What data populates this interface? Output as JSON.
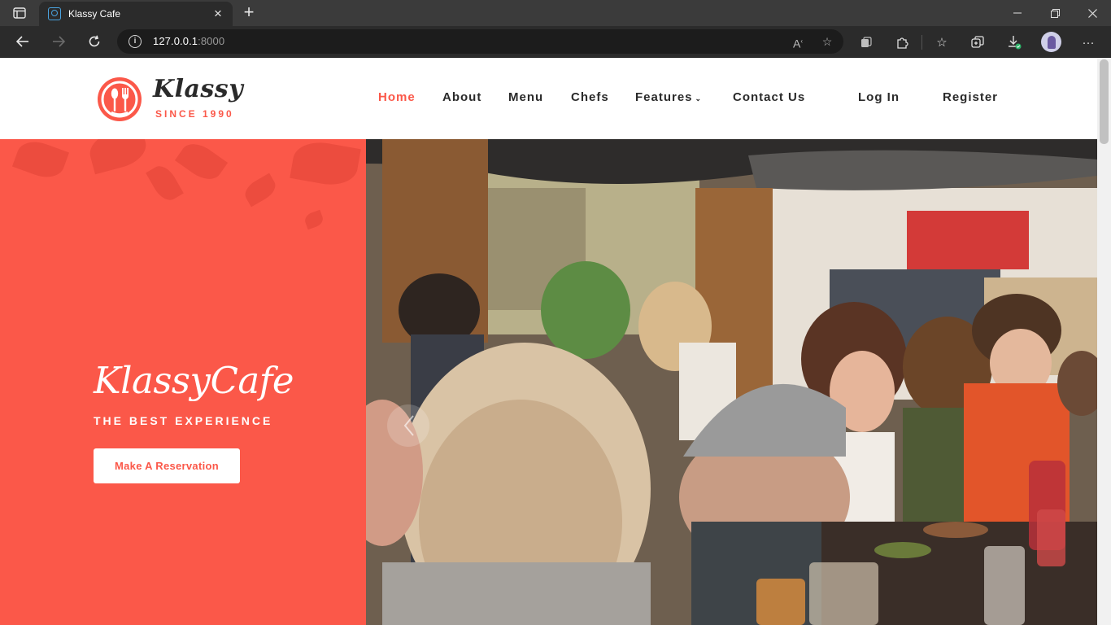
{
  "browser": {
    "tab_title": "Klassy Cafe",
    "url_host": "127.0.0.1",
    "url_port": ":8000",
    "icons": [
      "tab-actions-icon",
      "favicon-icon",
      "close-icon",
      "plus-icon",
      "minimize-icon",
      "maximize-icon",
      "close-window-icon",
      "back-icon",
      "forward-icon",
      "refresh-icon",
      "info-icon",
      "read-aloud-icon",
      "add-favorite-icon",
      "extensions-icon",
      "favorites-icon",
      "collections-icon",
      "downloads-icon",
      "profile-avatar",
      "more-icon"
    ]
  },
  "site": {
    "logo_name": "Klassy",
    "logo_since": "SINCE 1990",
    "nav": [
      {
        "label": "Home",
        "active": true
      },
      {
        "label": "About"
      },
      {
        "label": "Menu"
      },
      {
        "label": "Chefs"
      },
      {
        "label": "Features"
      },
      {
        "label": "Contact Us"
      },
      {
        "label": "Log In"
      },
      {
        "label": "Register"
      }
    ],
    "hero_title": "KlassyCafe",
    "hero_subtitle": "THE BEST EXPERIENCE",
    "hero_button": "Make A Reservation"
  },
  "colors": {
    "accent": "#fb5849",
    "text_dark": "#2a2a2a",
    "chrome_bg": "#3b3b3b"
  }
}
